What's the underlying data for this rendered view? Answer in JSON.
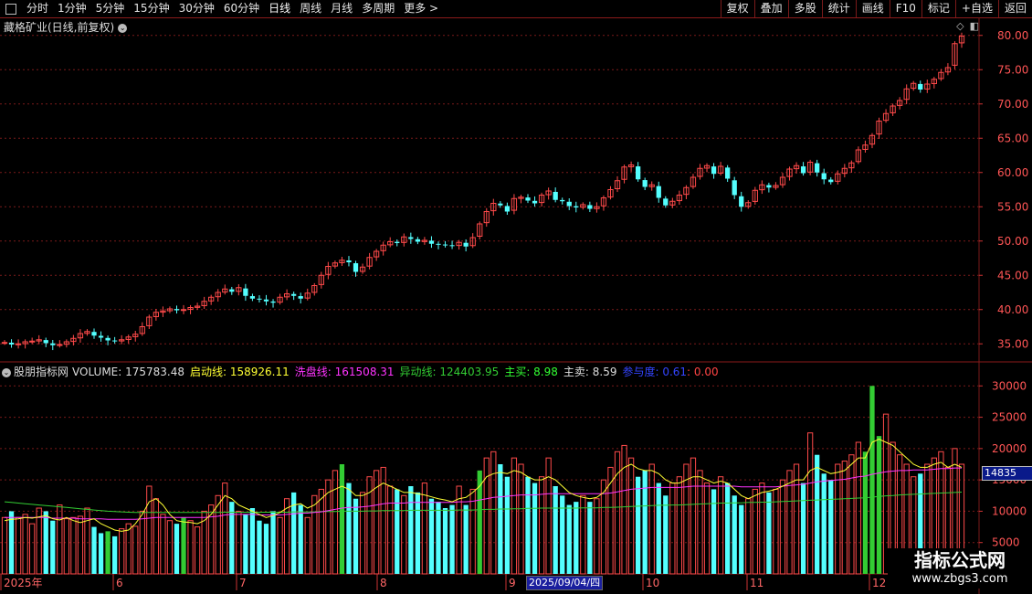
{
  "toolbar": {
    "left_items": [
      "分时",
      "1分钟",
      "5分钟",
      "15分钟",
      "30分钟",
      "60分钟",
      "日线",
      "周线",
      "月线",
      "多周期",
      "更多 >"
    ],
    "active": "日线",
    "right_items": [
      "复权",
      "叠加",
      "多股",
      "统计",
      "画线",
      "F10",
      "标记",
      "+自选",
      "返回"
    ]
  },
  "stock_title": "藏格矿业(日线,前复权)",
  "indicator": {
    "name": "股朋指标网",
    "volume_label": "VOLUME: 175783.48",
    "qidong_label": "启动线: 158926.11",
    "xipan_label": "洗盘线: 161508.31",
    "yidong_label": "异动线: 124403.95",
    "zhumai_label": "主买: 8.98",
    "zhumai2_label": "主卖: 8.59",
    "canyu_label": "参与度: 0.61",
    "extra_label": ": 0.00"
  },
  "price_axis": [
    "80.00",
    "75.00",
    "70.00",
    "65.00",
    "60.00",
    "55.00",
    "50.00",
    "45.00",
    "40.00",
    "35.00"
  ],
  "volume_axis": [
    "30000",
    "25000",
    "20000",
    "15000",
    "10000",
    "5000"
  ],
  "current_volume_tag": "14835",
  "x_axis": [
    {
      "label": "2025年"
    },
    {
      "label": "6"
    },
    {
      "label": "7"
    },
    {
      "label": "8"
    },
    {
      "label": "9"
    },
    {
      "label": "10"
    },
    {
      "label": "11"
    },
    {
      "label": "12"
    }
  ],
  "cursor_date": "2025/09/04/四",
  "watermark": {
    "title": "指标公式网",
    "url": "www.zbgs3.com"
  },
  "colors": {
    "up": "#ff4a4a",
    "down": "#54ffff",
    "grid": "#7a1a1a",
    "ma_yellow": "#ffff33",
    "ma_magenta": "#ff33ff",
    "ma_green": "#33cc33",
    "special": "#33cc33"
  },
  "chart_data": {
    "type": "candlestick",
    "price_range": [
      32.5,
      82.5
    ],
    "volume_range": [
      0,
      31500
    ],
    "closes": [
      35.2,
      34.9,
      35.0,
      35.3,
      35.4,
      35.6,
      35.1,
      34.8,
      34.9,
      35.3,
      35.8,
      36.5,
      36.8,
      36.2,
      35.9,
      35.5,
      35.4,
      35.6,
      36.0,
      36.4,
      37.5,
      38.9,
      39.6,
      39.8,
      40.1,
      39.9,
      40.0,
      40.3,
      40.5,
      41.2,
      41.8,
      42.5,
      43.0,
      42.6,
      43.2,
      42.0,
      41.6,
      41.5,
      41.2,
      41.0,
      41.8,
      42.3,
      42.0,
      41.6,
      42.4,
      43.5,
      45.0,
      46.3,
      46.8,
      47.2,
      46.9,
      45.5,
      46.2,
      47.6,
      48.5,
      49.4,
      49.9,
      49.7,
      50.6,
      50.3,
      49.9,
      50.1,
      49.6,
      49.5,
      49.4,
      49.3,
      49.8,
      49.2,
      50.5,
      52.5,
      54.3,
      55.5,
      55.2,
      54.3,
      56.2,
      56.4,
      55.9,
      55.5,
      56.7,
      57.3,
      56.0,
      55.8,
      55.1,
      54.9,
      55.3,
      54.7,
      55.0,
      56.3,
      57.5,
      58.8,
      60.8,
      61.1,
      59.0,
      57.9,
      58.2,
      56.3,
      55.2,
      55.8,
      56.7,
      57.8,
      59.3,
      60.6,
      61.0,
      59.8,
      60.9,
      59.1,
      56.7,
      55.0,
      55.6,
      57.4,
      58.2,
      57.8,
      58.1,
      59.3,
      60.5,
      61.0,
      59.9,
      61.5,
      60.0,
      59.0,
      58.6,
      59.8,
      60.6,
      61.4,
      63.3,
      64.0,
      65.4,
      67.5,
      68.6,
      69.7,
      70.5,
      72.2,
      73.0,
      72.1,
      72.9,
      73.6,
      74.6,
      75.3,
      78.8,
      79.9
    ],
    "volumes": [
      9000,
      10000,
      9000,
      9500,
      8000,
      10500,
      10000,
      8500,
      11000,
      8800,
      9000,
      9200,
      10500,
      7500,
      6500,
      6800,
      6000,
      7200,
      8000,
      7600,
      10000,
      14000,
      12000,
      9500,
      8500,
      8000,
      9000,
      8500,
      7500,
      10000,
      11000,
      12500,
      14500,
      11500,
      10000,
      9500,
      10500,
      8500,
      8000,
      10000,
      9000,
      12000,
      13000,
      11000,
      9000,
      12500,
      13500,
      15000,
      16500,
      17500,
      14500,
      12000,
      13000,
      15500,
      16500,
      17000,
      14000,
      13500,
      12500,
      14000,
      13000,
      14500,
      12000,
      11500,
      10500,
      11000,
      14000,
      11000,
      13500,
      16500,
      18500,
      19500,
      17500,
      15500,
      18500,
      17500,
      15500,
      14500,
      15500,
      18500,
      14000,
      12500,
      11000,
      11500,
      12500,
      11500,
      12000,
      15000,
      17000,
      19500,
      20500,
      18500,
      15500,
      16500,
      17500,
      14500,
      12500,
      14500,
      15500,
      17500,
      18500,
      16500,
      14500,
      13500,
      15500,
      14500,
      12500,
      11000,
      12000,
      13500,
      14500,
      13000,
      13500,
      15000,
      16500,
      17500,
      14500,
      22500,
      19000,
      16000,
      15000,
      17500,
      18000,
      19000,
      21000,
      19500,
      30000,
      22000,
      25500,
      21000,
      19000,
      17500,
      15500,
      16000,
      17500,
      18500,
      19500,
      17000,
      20000,
      17500
    ],
    "ma_yellow": [
      8500,
      8700,
      8800,
      9000,
      8900,
      9100,
      9300,
      8800,
      8600,
      9000,
      8500,
      8200,
      8500,
      8800,
      8000,
      7500,
      7000,
      6800,
      7000,
      8000,
      9500,
      11500,
      12000,
      11000,
      9500,
      8500,
      8300,
      8200,
      8000,
      8500,
      9500,
      11000,
      12500,
      12000,
      11000,
      10500,
      10000,
      9500,
      9000,
      9300,
      9800,
      10500,
      11000,
      11200,
      10500,
      11000,
      12000,
      13000,
      13500,
      14000,
      13500,
      12500,
      12500,
      13000,
      13800,
      14500,
      14000,
      13500,
      13000,
      13000,
      12800,
      12600,
      12300,
      12000,
      11800,
      11500,
      12000,
      12200,
      13000,
      14000,
      15500,
      16000,
      16200,
      16000,
      16500,
      16200,
      15500,
      15000,
      15000,
      15500,
      15000,
      14000,
      13000,
      12500,
      12200,
      12000,
      12200,
      13000,
      14500,
      16000,
      17000,
      17500,
      16800,
      16500,
      16500,
      16000,
      15000,
      14500,
      14500,
      15000,
      15500,
      15500,
      15000,
      14500,
      14800,
      14500,
      13500,
      12500,
      12000,
      12500,
      13000,
      13200,
      13500,
      14000,
      14500,
      15000,
      15000,
      16500,
      17000,
      16500,
      16000,
      16200,
      16500,
      17500,
      18500,
      18500,
      21000,
      21500,
      21000,
      20500,
      19500,
      18500,
      17500,
      17000,
      17000,
      17500,
      17800,
      17000,
      17500,
      17000
    ],
    "ma_magenta": [
      9000,
      9000,
      9000,
      9000,
      9000,
      9000,
      9000,
      8900,
      8900,
      8900,
      8900,
      8800,
      8800,
      8800,
      8800,
      8700,
      8700,
      8700,
      8700,
      8700,
      8800,
      8900,
      9000,
      9000,
      9000,
      9000,
      9000,
      9000,
      9000,
      9000,
      9100,
      9200,
      9400,
      9500,
      9500,
      9500,
      9500,
      9400,
      9400,
      9400,
      9400,
      9500,
      9600,
      9700,
      9700,
      9800,
      9900,
      10100,
      10300,
      10500,
      10600,
      10600,
      10700,
      10800,
      11000,
      11200,
      11300,
      11300,
      11300,
      11400,
      11400,
      11400,
      11400,
      11400,
      11400,
      11400,
      11500,
      11500,
      11600,
      11800,
      12000,
      12200,
      12300,
      12400,
      12500,
      12600,
      12600,
      12600,
      12700,
      12800,
      12800,
      12800,
      12800,
      12800,
      12800,
      12800,
      12800,
      12800,
      12900,
      13100,
      13300,
      13500,
      13600,
      13700,
      13800,
      13800,
      13800,
      13800,
      13800,
      13900,
      14000,
      14000,
      14000,
      14000,
      14000,
      14000,
      14000,
      13900,
      13900,
      13900,
      13900,
      13900,
      13900,
      14000,
      14100,
      14200,
      14300,
      14500,
      14700,
      14800,
      14900,
      15000,
      15100,
      15300,
      15500,
      15600,
      15900,
      16100,
      16300,
      16400,
      16500,
      16500,
      16600,
      16600,
      16600,
      16700,
      16800,
      16800,
      16900,
      16900
    ],
    "ma_green": [
      11500,
      11400,
      11300,
      11200,
      11100,
      11000,
      10900,
      10800,
      10700,
      10600,
      10500,
      10400,
      10300,
      10200,
      10100,
      10000,
      9950,
      9900,
      9850,
      9800,
      9800,
      9800,
      9800,
      9800,
      9800,
      9800,
      9800,
      9800,
      9800,
      9800,
      9800,
      9800,
      9850,
      9850,
      9850,
      9850,
      9850,
      9850,
      9850,
      9850,
      9850,
      9850,
      9900,
      9900,
      9900,
      9900,
      9950,
      9950,
      9950,
      10000,
      10000,
      10000,
      10000,
      10050,
      10050,
      10100,
      10100,
      10100,
      10100,
      10150,
      10150,
      10150,
      10150,
      10150,
      10150,
      10150,
      10200,
      10200,
      10200,
      10250,
      10300,
      10300,
      10350,
      10350,
      10400,
      10400,
      10450,
      10450,
      10500,
      10500,
      10500,
      10500,
      10500,
      10500,
      10550,
      10550,
      10550,
      10600,
      10600,
      10650,
      10700,
      10750,
      10800,
      10850,
      10900,
      10950,
      10950,
      11000,
      11000,
      11050,
      11100,
      11150,
      11200,
      11250,
      11300,
      11300,
      11350,
      11350,
      11400,
      11400,
      11450,
      11450,
      11500,
      11550,
      11600,
      11650,
      11700,
      11750,
      11800,
      11850,
      11900,
      11950,
      12000,
      12050,
      12100,
      12150,
      12250,
      12350,
      12450,
      12500,
      12600,
      12650,
      12700,
      12750,
      12800,
      12850,
      12900,
      12950,
      13000,
      13050
    ],
    "special_green_indices": [
      15,
      26,
      49,
      69,
      125,
      126,
      127
    ]
  }
}
